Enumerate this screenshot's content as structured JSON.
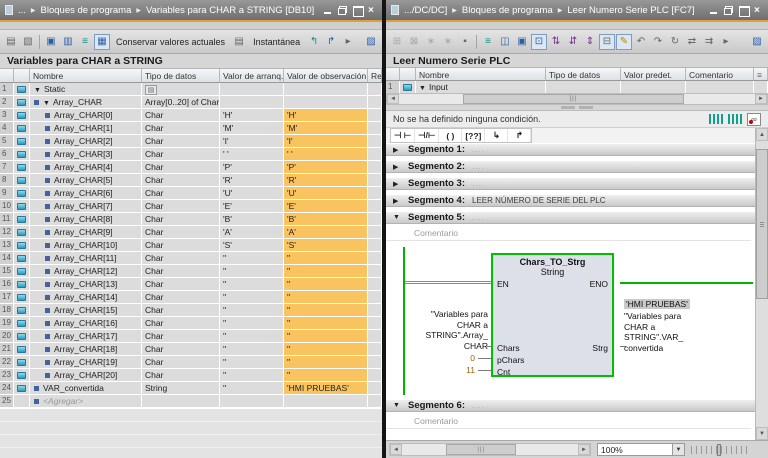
{
  "icons": {
    "close": "×",
    "crumb_sep": "▶",
    "collapsed": "▶",
    "expanded": "▼",
    "dropdown": "▼",
    "overflow": "▸",
    "left": "◄",
    "right": "►",
    "up": "▲",
    "down": "▼",
    "grip": "|||",
    "type_button": "▤",
    "interface_settings": "≡"
  },
  "colors": {
    "orange_highlight": "#f9c45f",
    "titlebar_accent": "#dfa039",
    "power_rail_green": "#00b400",
    "block_border_green": "#00c000",
    "constant_value": "#a85e00"
  },
  "left_panel": {
    "titlebar": {
      "crumbs": [
        "...",
        "Bloques de programa",
        "Variables para CHAR a STRING [DB10]"
      ]
    },
    "toolbar": {
      "items": [
        {
          "t": "icon",
          "name": "insert-row-icon",
          "glyph": "▤",
          "cls": "gray"
        },
        {
          "t": "icon",
          "name": "add-row-icon",
          "glyph": "▧",
          "cls": "gray"
        },
        {
          "t": "sep"
        },
        {
          "t": "icon",
          "name": "keep-actual-values-icon",
          "glyph": "▣",
          "cls": "blue"
        },
        {
          "t": "icon",
          "name": "snapshot-values-icon",
          "glyph": "▥",
          "cls": "blue"
        },
        {
          "t": "icon",
          "name": "expand-members-icon",
          "glyph": "≡",
          "cls": "teal"
        },
        {
          "t": "icon",
          "name": "monitor-all-icon",
          "glyph": "▦",
          "cls": "blue pressed"
        },
        {
          "t": "btn",
          "name": "keep-values-button",
          "label": "Conservar valores actuales"
        },
        {
          "t": "icon",
          "name": "load-start-values-icon",
          "glyph": "▤",
          "cls": "gray"
        },
        {
          "t": "btn",
          "name": "snapshot-button",
          "label": "Instantánea"
        },
        {
          "t": "icon",
          "name": "copy-snapshot-to-start-icon",
          "glyph": "↰",
          "cls": "teal"
        },
        {
          "t": "icon",
          "name": "copy-start-values-icon",
          "glyph": "↱",
          "cls": "blue"
        },
        {
          "t": "icon",
          "name": "overflow-arrow-icon",
          "glyph": "▸",
          "cls": "gray"
        },
        {
          "t": "spacer"
        },
        {
          "t": "icon",
          "name": "edit-table-icon",
          "glyph": "▨",
          "cls": "blue"
        }
      ]
    },
    "heading": "Variables para CHAR a STRING",
    "table": {
      "columns": [
        "Nombre",
        "Tipo de datos",
        "Valor de arranq...",
        "Valor de observación",
        "Re..."
      ],
      "rows": [
        {
          "n": "1",
          "name": "Static",
          "type": "",
          "start": "",
          "watch": "",
          "pad": 2,
          "expander": true,
          "icon": true,
          "square": false,
          "orange": false,
          "typebtn": true
        },
        {
          "n": "2",
          "name": "Array_CHAR",
          "type": "Array[0..20] of Char",
          "start": "",
          "watch": "",
          "pad": 2,
          "expander": true,
          "icon": true,
          "square": true,
          "orange": false
        },
        {
          "n": "3",
          "name": "Array_CHAR[0]",
          "type": "Char",
          "start": "'H'",
          "watch": "'H'",
          "pad": 13,
          "icon": true,
          "square": true,
          "orange": true
        },
        {
          "n": "4",
          "name": "Array_CHAR[1]",
          "type": "Char",
          "start": "'M'",
          "watch": "'M'",
          "pad": 13,
          "icon": true,
          "square": true,
          "orange": true
        },
        {
          "n": "5",
          "name": "Array_CHAR[2]",
          "type": "Char",
          "start": "'I'",
          "watch": "'I'",
          "pad": 13,
          "icon": true,
          "square": true,
          "orange": true
        },
        {
          "n": "6",
          "name": "Array_CHAR[3]",
          "type": "Char",
          "start": "' '",
          "watch": "' '",
          "pad": 13,
          "icon": true,
          "square": true,
          "orange": true
        },
        {
          "n": "7",
          "name": "Array_CHAR[4]",
          "type": "Char",
          "start": "'P'",
          "watch": "'P'",
          "pad": 13,
          "icon": true,
          "square": true,
          "orange": true
        },
        {
          "n": "8",
          "name": "Array_CHAR[5]",
          "type": "Char",
          "start": "'R'",
          "watch": "'R'",
          "pad": 13,
          "icon": true,
          "square": true,
          "orange": true
        },
        {
          "n": "9",
          "name": "Array_CHAR[6]",
          "type": "Char",
          "start": "'U'",
          "watch": "'U'",
          "pad": 13,
          "icon": true,
          "square": true,
          "orange": true
        },
        {
          "n": "10",
          "name": "Array_CHAR[7]",
          "type": "Char",
          "start": "'E'",
          "watch": "'E'",
          "pad": 13,
          "icon": true,
          "square": true,
          "orange": true
        },
        {
          "n": "11",
          "name": "Array_CHAR[8]",
          "type": "Char",
          "start": "'B'",
          "watch": "'B'",
          "pad": 13,
          "icon": true,
          "square": true,
          "orange": true
        },
        {
          "n": "12",
          "name": "Array_CHAR[9]",
          "type": "Char",
          "start": "'A'",
          "watch": "'A'",
          "pad": 13,
          "icon": true,
          "square": true,
          "orange": true
        },
        {
          "n": "13",
          "name": "Array_CHAR[10]",
          "type": "Char",
          "start": "'S'",
          "watch": "'S'",
          "pad": 13,
          "icon": true,
          "square": true,
          "orange": true
        },
        {
          "n": "14",
          "name": "Array_CHAR[11]",
          "type": "Char",
          "start": "''",
          "watch": "''",
          "pad": 13,
          "icon": true,
          "square": true,
          "orange": true
        },
        {
          "n": "15",
          "name": "Array_CHAR[12]",
          "type": "Char",
          "start": "''",
          "watch": "''",
          "pad": 13,
          "icon": true,
          "square": true,
          "orange": true
        },
        {
          "n": "16",
          "name": "Array_CHAR[13]",
          "type": "Char",
          "start": "''",
          "watch": "''",
          "pad": 13,
          "icon": true,
          "square": true,
          "orange": true
        },
        {
          "n": "17",
          "name": "Array_CHAR[14]",
          "type": "Char",
          "start": "''",
          "watch": "''",
          "pad": 13,
          "icon": true,
          "square": true,
          "orange": true
        },
        {
          "n": "18",
          "name": "Array_CHAR[15]",
          "type": "Char",
          "start": "''",
          "watch": "''",
          "pad": 13,
          "icon": true,
          "square": true,
          "orange": true
        },
        {
          "n": "19",
          "name": "Array_CHAR[16]",
          "type": "Char",
          "start": "''",
          "watch": "''",
          "pad": 13,
          "icon": true,
          "square": true,
          "orange": true
        },
        {
          "n": "20",
          "name": "Array_CHAR[17]",
          "type": "Char",
          "start": "''",
          "watch": "''",
          "pad": 13,
          "icon": true,
          "square": true,
          "orange": true
        },
        {
          "n": "21",
          "name": "Array_CHAR[18]",
          "type": "Char",
          "start": "''",
          "watch": "''",
          "pad": 13,
          "icon": true,
          "square": true,
          "orange": true
        },
        {
          "n": "22",
          "name": "Array_CHAR[19]",
          "type": "Char",
          "start": "''",
          "watch": "''",
          "pad": 13,
          "icon": true,
          "square": true,
          "orange": true
        },
        {
          "n": "23",
          "name": "Array_CHAR[20]",
          "type": "Char",
          "start": "''",
          "watch": "''",
          "pad": 13,
          "icon": true,
          "square": true,
          "orange": true
        },
        {
          "n": "24",
          "name": "VAR_convertida",
          "type": "String",
          "start": "''",
          "watch": "'HMI PRUEBAS'",
          "pad": 2,
          "icon": true,
          "square": true,
          "orange": true
        },
        {
          "n": "25",
          "name": "<Agregar>",
          "type": "",
          "start": "",
          "watch": "",
          "pad": 2,
          "square": true,
          "add": true,
          "orange": false
        }
      ]
    }
  },
  "right_panel": {
    "titlebar": {
      "crumbs": [
        ".../DC/DC]",
        "Bloques de programa",
        "Leer Numero Serie PLC [FC7]"
      ]
    },
    "toolbar": {
      "items": [
        {
          "t": "icon",
          "name": "insert-network-icon",
          "glyph": "⊞",
          "cls": "gray disabled"
        },
        {
          "t": "icon",
          "name": "delete-network-icon",
          "glyph": "⊠",
          "cls": "gray disabled"
        },
        {
          "t": "icon",
          "name": "reset-start-values-icon",
          "glyph": "∗",
          "cls": "gray disabled"
        },
        {
          "t": "icon",
          "name": "settings-icon",
          "glyph": "∗",
          "cls": "gray disabled"
        },
        {
          "t": "icon",
          "name": "block-interface-icon",
          "glyph": "▪",
          "cls": "gray"
        },
        {
          "t": "sep"
        },
        {
          "t": "icon",
          "name": "list-structure-icon",
          "glyph": "≡",
          "cls": "teal"
        },
        {
          "t": "icon",
          "name": "split-editor-icon",
          "glyph": "◫",
          "cls": "blue"
        },
        {
          "t": "icon",
          "name": "editor-window-icon",
          "glyph": "▣",
          "cls": "blue"
        },
        {
          "t": "icon",
          "name": "comments-toggle-icon",
          "glyph": "⊡",
          "cls": "blue pressed"
        },
        {
          "t": "icon",
          "name": "operand-info-icon",
          "glyph": "⇅",
          "cls": "purple"
        },
        {
          "t": "icon",
          "name": "memory-info-icon",
          "glyph": "⇵",
          "cls": "purple"
        },
        {
          "t": "icon",
          "name": "symbol-info-icon",
          "glyph": "⇕",
          "cls": "purple"
        },
        {
          "t": "icon",
          "name": "absolute-operands-icon",
          "glyph": "⊟",
          "cls": "gray pressed"
        },
        {
          "t": "icon",
          "name": "free-comments-icon",
          "glyph": "✎",
          "cls": "amber pressed"
        },
        {
          "t": "icon",
          "name": "jump-back-icon",
          "glyph": "↶",
          "cls": "gray"
        },
        {
          "t": "icon",
          "name": "jump-forward-icon",
          "glyph": "↷",
          "cls": "gray"
        },
        {
          "t": "icon",
          "name": "update-calls-icon",
          "glyph": "↻",
          "cls": "gray"
        },
        {
          "t": "icon",
          "name": "call-structure-icon",
          "glyph": "⇄",
          "cls": "gray"
        },
        {
          "t": "icon",
          "name": "consistency-icon",
          "glyph": "⇉",
          "cls": "gray"
        },
        {
          "t": "icon",
          "name": "overflow-arrow-icon",
          "glyph": "▸",
          "cls": "gray"
        },
        {
          "t": "spacer"
        },
        {
          "t": "icon",
          "name": "edit-block-icon",
          "glyph": "▨",
          "cls": "blue"
        }
      ]
    },
    "heading": "Leer Numero Serie PLC",
    "interface": {
      "columns": [
        "Nombre",
        "Tipo de datos",
        "Valor predet.",
        "Comentario"
      ],
      "row_number": "1",
      "row_name": "Input"
    },
    "condition_text": "No se ha definido ninguna condición.",
    "ladder_tools": [
      {
        "name": "no-contact-icon",
        "glyph": "⊣ ⊢"
      },
      {
        "name": "nc-contact-icon",
        "glyph": "⊣/⊢"
      },
      {
        "name": "coil-icon",
        "glyph": "( )"
      },
      {
        "name": "empty-box-icon",
        "glyph": "[??]"
      },
      {
        "name": "open-branch-icon",
        "glyph": "↳"
      },
      {
        "name": "close-branch-icon",
        "glyph": "↱"
      }
    ],
    "segments": [
      {
        "label": "Segmento 1:",
        "comment": "....",
        "expanded": false
      },
      {
        "label": "Segmento 2:",
        "comment": "....",
        "expanded": false
      },
      {
        "label": "Segmento 3:",
        "comment": "....",
        "expanded": false
      },
      {
        "label": "Segmento 4:",
        "comment": "LEER NÚMERO DE SERIE DEL PLC",
        "expanded": false,
        "comment_dark": true
      },
      {
        "label": "Segmento 5:",
        "comment": "....",
        "expanded": true,
        "placeholder": "Comentario",
        "network": true
      },
      {
        "label": "Segmento 6:",
        "comment": "....",
        "expanded": true,
        "placeholder": "Comentario"
      }
    ],
    "network": {
      "block_title": "Chars_TO_Strg",
      "block_subtitle": "String",
      "pin_en": "EN",
      "pin_eno": "ENO",
      "pin_chars": "Chars",
      "pin_pchars": "pChars",
      "pin_cnt": "Cnt",
      "pin_strg": "Strg",
      "input_operand": "\"Variables para\nCHAR a\nSTRING\".Array_\nCHAR",
      "pchars_value": "0",
      "cnt_value": "11",
      "output_monitor": "'HMI PRUEBAS'",
      "output_operand": "\"Variables para\nCHAR a\nSTRING\".VAR_\nconvertida"
    },
    "statusbar": {
      "zoom_value": "100%"
    }
  }
}
